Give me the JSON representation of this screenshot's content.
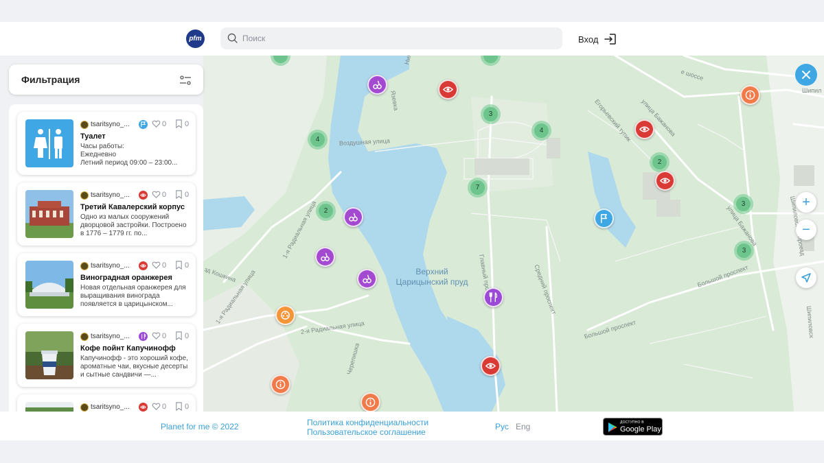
{
  "header": {
    "logo_text": "pfm",
    "search_placeholder": "Поиск",
    "login_label": "Вход"
  },
  "sidebar": {
    "filter_title": "Фильтрация",
    "cards": [
      {
        "author": "tsaritsyno_...",
        "category": "toilet",
        "category_color": "#3fa7e3",
        "likes": "0",
        "bookmarks": "0",
        "name": "Туалет",
        "description": "Часы работы:\nЕжедневно\nЛетний период 09:00 – 23:00..."
      },
      {
        "author": "tsaritsyno_...",
        "category": "sight",
        "category_color": "#d93a35",
        "likes": "0",
        "bookmarks": "0",
        "name": "Третий Кавалерский корпус",
        "description": "Одно из малых сооружений дворцовой застройки. Построено в 1776 – 1779 гг. по..."
      },
      {
        "author": "tsaritsyno_...",
        "category": "sight",
        "category_color": "#d93a35",
        "likes": "0",
        "bookmarks": "0",
        "name": "Виноградная оранжерея",
        "description": "Новая отдельная оранжерея для выращивания винограда появляется в царицынском..."
      },
      {
        "author": "tsaritsyno_...",
        "category": "food",
        "category_color": "#9a4ad6",
        "likes": "0",
        "bookmarks": "0",
        "name": "Кофе пойнт Капучинофф",
        "description": "Капучинофф - это хороший кофе, ароматные чаи, вкусные десерты и сытные сандвичи —..."
      },
      {
        "author": "tsaritsyno_...",
        "category": "sight",
        "category_color": "#d93a35",
        "likes": "0",
        "bookmarks": "0",
        "name": "",
        "description": ""
      }
    ]
  },
  "map": {
    "streets": [
      "Воздушная улица",
      "1-я Радиальная улица",
      "2-я Радиальная улица",
      "1-я Радиальная улица",
      "зд Кошкина",
      "Черепишка",
      "Главный проспект",
      "Средний проспект",
      "Большой проспект",
      "Большой проспект",
      "Егорьевский тупик",
      "улица Бажанова",
      "улица Бажанова",
      "Шипиловский проезд",
      "Шипиловск",
      "Шипил",
      "е шоссе",
      "Язевка",
      "Ниж"
    ],
    "water_label": "Верхний\nЦарицынский пруд",
    "clusters": [
      "3",
      "4",
      "4",
      "2",
      "7",
      "2",
      "3",
      "3"
    ],
    "zoom_in": "+",
    "zoom_out": "−"
  },
  "footer": {
    "copyright": "Planet for me © 2022",
    "privacy": "Политика конфиденциальности",
    "terms": "Пользовательское соглашение",
    "lang_ru": "Рус",
    "lang_en": "Eng",
    "gplay_small": "ДОСТУПНО В",
    "gplay_big": "Google Play"
  },
  "colors": {
    "accent": "#3aa0d8",
    "sight": "#d93a35",
    "playground": "#a34ad0",
    "food": "#9a4ad6",
    "info": "#f07a4a",
    "entertainment": "#f5953a",
    "flag": "#3fa7e3",
    "cluster": "#6dc48c"
  }
}
